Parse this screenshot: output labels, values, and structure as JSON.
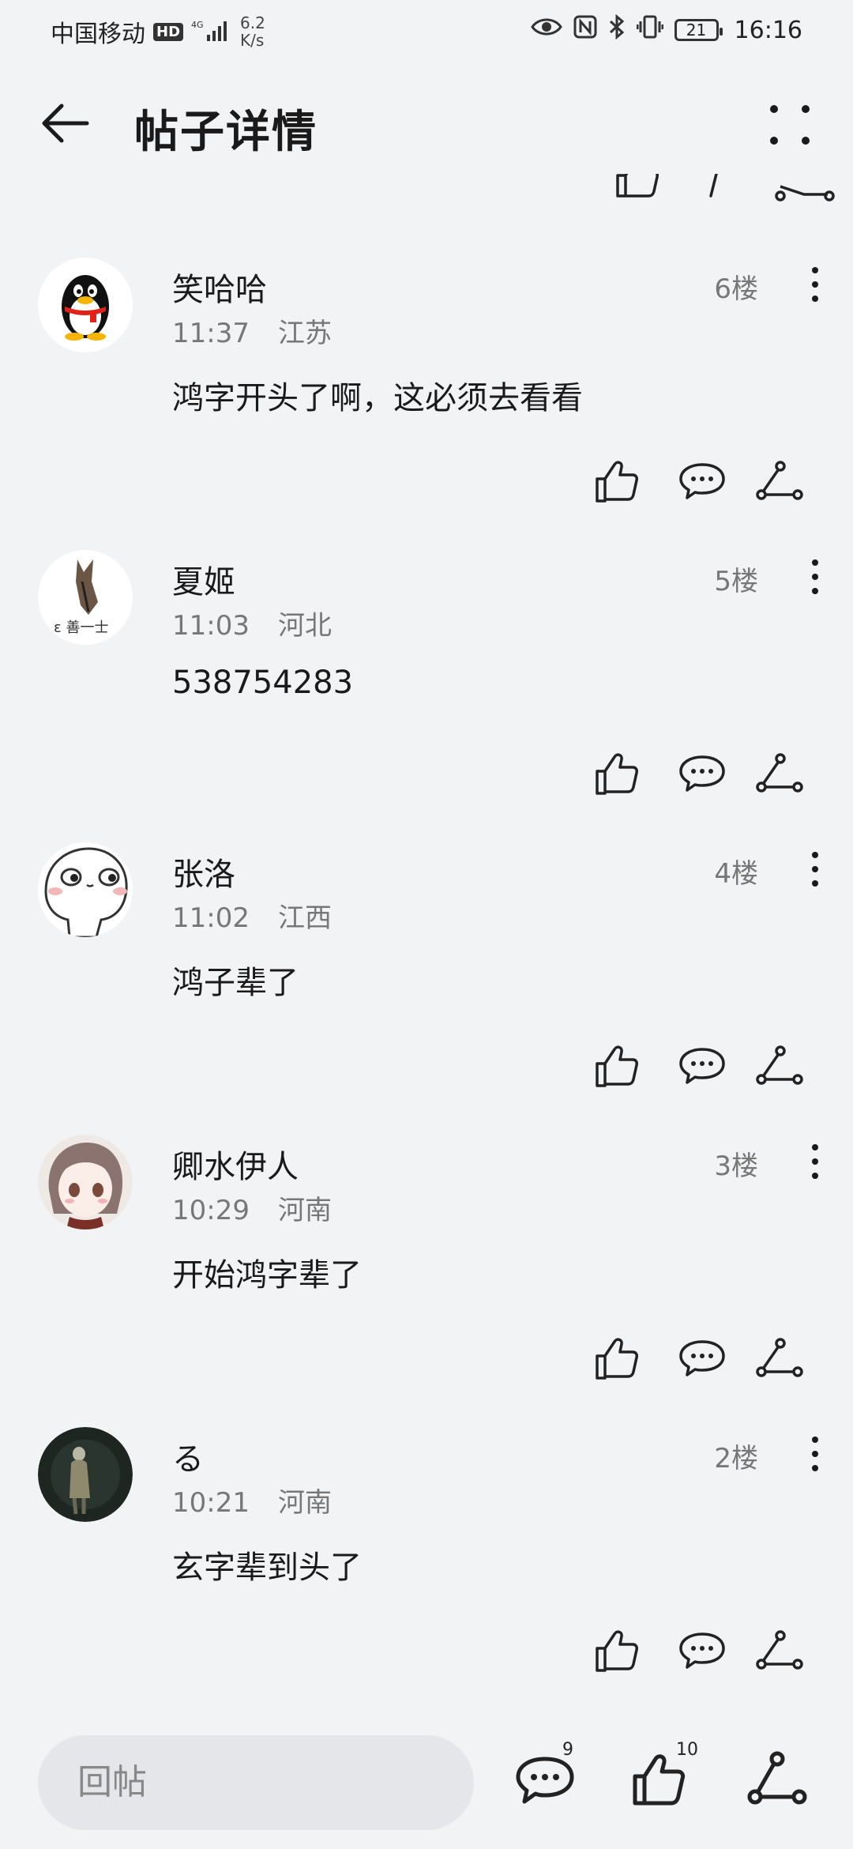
{
  "status_bar": {
    "carrier": "中国移动",
    "hd": "HD",
    "network": "4G",
    "speed_top": "6.2",
    "speed_bottom": "K/s",
    "battery": "21",
    "time": "16:16"
  },
  "header": {
    "title": "帖子详情"
  },
  "posts": [
    {
      "name": "笑哈哈",
      "time": "11:37",
      "location": "江苏",
      "floor": "6楼",
      "content": "鸿字开头了啊，这必须去看看"
    },
    {
      "name": "夏姬",
      "time": "11:03",
      "location": "河北",
      "floor": "5楼",
      "content": "538754283"
    },
    {
      "name": "张洛",
      "time": "11:02",
      "location": "江西",
      "floor": "4楼",
      "content": "鸿子辈了"
    },
    {
      "name": "卿水伊人",
      "time": "10:29",
      "location": "河南",
      "floor": "3楼",
      "content": "开始鸿字辈了"
    },
    {
      "name": "る",
      "time": "10:21",
      "location": "河南",
      "floor": "2楼",
      "content": "玄字辈到头了"
    }
  ],
  "bottom_bar": {
    "reply_placeholder": "回帖",
    "comment_count": "9",
    "like_count": "10"
  },
  "avatar_text": "ε 善一士"
}
